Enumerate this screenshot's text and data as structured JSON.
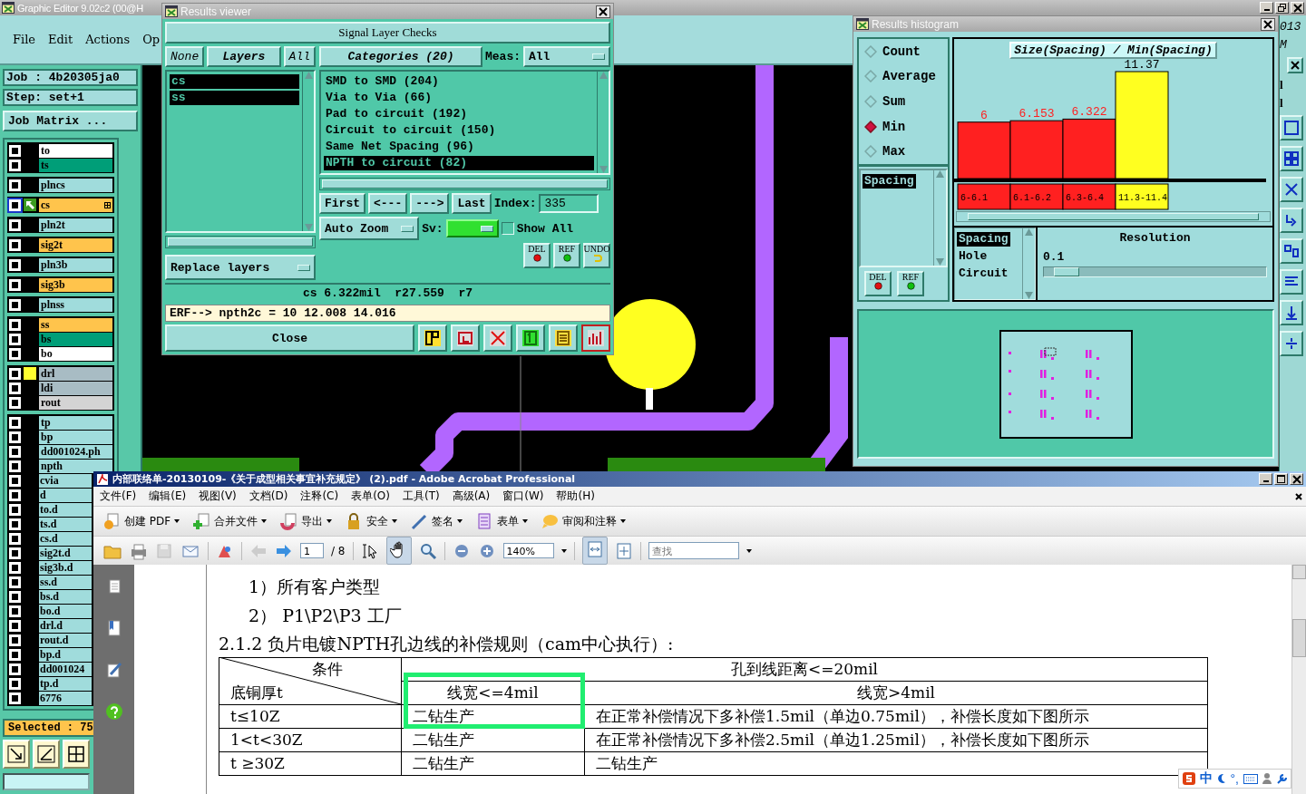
{
  "editor": {
    "title": "Graphic Editor 9.02c2 (00@H",
    "menu": [
      "File",
      "Edit",
      "Actions",
      "Op"
    ],
    "job": "Job : 4b20305ja0",
    "step": "Step: set+1",
    "job_matrix": "Job Matrix ...",
    "layer_groups": [
      [
        {
          "name": "to",
          "color": "#ffffff",
          "selected": false,
          "marked": false
        },
        {
          "name": "ts",
          "color": "#009e78",
          "selected": false,
          "marked": false
        }
      ],
      [
        {
          "name": "plncs",
          "color": "#a0dcdc",
          "selected": false,
          "marked": false
        }
      ],
      [
        {
          "name": "cs",
          "color": "#ffc44c",
          "selected": true,
          "marked": false
        }
      ],
      [
        {
          "name": "pln2t",
          "color": "#a0dcdc",
          "selected": false,
          "marked": false
        }
      ],
      [
        {
          "name": "sig2t",
          "color": "#ffc44c",
          "selected": false,
          "marked": false
        }
      ],
      [
        {
          "name": "pln3b",
          "color": "#a0dcdc",
          "selected": false,
          "marked": false
        }
      ],
      [
        {
          "name": "sig3b",
          "color": "#ffc44c",
          "selected": false,
          "marked": false
        }
      ],
      [
        {
          "name": "plnss",
          "color": "#a0dcdc",
          "selected": false,
          "marked": false
        }
      ],
      [
        {
          "name": "ss",
          "color": "#ffc44c",
          "selected": false,
          "marked": false
        },
        {
          "name": "bs",
          "color": "#009e78",
          "selected": false,
          "marked": false
        },
        {
          "name": "bo",
          "color": "#ffffff",
          "selected": false,
          "marked": false
        }
      ],
      [
        {
          "name": "drl",
          "color": "#a8bcc4",
          "selected": false,
          "marked": true
        },
        {
          "name": "ldi",
          "color": "#a8bcc4",
          "selected": false,
          "marked": false
        },
        {
          "name": "rout",
          "color": "#d4d4d4",
          "selected": false,
          "marked": false
        }
      ],
      [
        {
          "name": "tp",
          "color": "#a0dcdc",
          "selected": false,
          "marked": false
        },
        {
          "name": "bp",
          "color": "#a0dcdc",
          "selected": false,
          "marked": false
        },
        {
          "name": "dd001024.ph",
          "color": "#a0dcdc",
          "selected": false,
          "marked": false
        },
        {
          "name": "npth",
          "color": "#a0dcdc",
          "selected": false,
          "marked": false
        },
        {
          "name": "cvia",
          "color": "#a0dcdc",
          "selected": false,
          "marked": false
        },
        {
          "name": "d",
          "color": "#a0dcdc",
          "selected": false,
          "marked": false
        },
        {
          "name": "to.d",
          "color": "#a0dcdc",
          "selected": false,
          "marked": false
        },
        {
          "name": "ts.d",
          "color": "#a0dcdc",
          "selected": false,
          "marked": false
        },
        {
          "name": "cs.d",
          "color": "#a0dcdc",
          "selected": false,
          "marked": false
        },
        {
          "name": "sig2t.d",
          "color": "#a0dcdc",
          "selected": false,
          "marked": false
        },
        {
          "name": "sig3b.d",
          "color": "#a0dcdc",
          "selected": false,
          "marked": false
        },
        {
          "name": "ss.d",
          "color": "#a0dcdc",
          "selected": false,
          "marked": false
        },
        {
          "name": "bs.d",
          "color": "#a0dcdc",
          "selected": false,
          "marked": false
        },
        {
          "name": "bo.d",
          "color": "#a0dcdc",
          "selected": false,
          "marked": false
        },
        {
          "name": "drl.d",
          "color": "#a0dcdc",
          "selected": false,
          "marked": false
        },
        {
          "name": "rout.d",
          "color": "#a0dcdc",
          "selected": false,
          "marked": false
        },
        {
          "name": "bp.d",
          "color": "#a0dcdc",
          "selected": false,
          "marked": false
        },
        {
          "name": "dd001024",
          "color": "#a0dcdc",
          "selected": false,
          "marked": false
        },
        {
          "name": "tp.d",
          "color": "#a0dcdc",
          "selected": false,
          "marked": false
        },
        {
          "name": "6776",
          "color": "#a0dcdc",
          "selected": false,
          "marked": false
        }
      ]
    ],
    "selected_count": "Selected : 75",
    "corner_texts": [
      "013",
      "M"
    ],
    "strip_labels": [
      "l",
      "l"
    ]
  },
  "results_viewer": {
    "title": "Results viewer",
    "header": "Signal Layer Checks",
    "layer_buttons": [
      "None",
      "Layers",
      "All"
    ],
    "layers": [
      {
        "name": "cs",
        "selected": true
      },
      {
        "name": "ss",
        "selected": true
      }
    ],
    "categories_button": "Categories (20)",
    "meas_label": "Meas:",
    "meas_value": "All",
    "categories": [
      {
        "name": "SMD to SMD (204)",
        "selected": false
      },
      {
        "name": "Via to Via (66)",
        "selected": false
      },
      {
        "name": "Pad to circuit (192)",
        "selected": false
      },
      {
        "name": "Circuit to circuit (150)",
        "selected": false
      },
      {
        "name": "Same Net Spacing (96)",
        "selected": false
      },
      {
        "name": "NPTH to circuit (82)",
        "selected": true
      }
    ],
    "nav_buttons": [
      "First",
      "<---",
      "--->",
      "Last"
    ],
    "index_label": "Index:",
    "index_value": "335",
    "zoom_mode": "Auto Zoom",
    "sv_label": "Sv:",
    "show_all": {
      "label": "Show All",
      "checked": false
    },
    "replace_mode": "Replace layers",
    "mark_buttons": [
      "DEL",
      "REF",
      "UNDO"
    ],
    "status": "cs 6.322mil  r27.559  r7",
    "erf": "ERF--> npth2c = 10 12.008 14.016",
    "close": "Close"
  },
  "results_histogram": {
    "title": "Results histogram",
    "modes": [
      {
        "label": "Count",
        "selected": false
      },
      {
        "label": "Average",
        "selected": false
      },
      {
        "label": "Sum",
        "selected": false
      },
      {
        "label": "Min",
        "selected": true
      },
      {
        "label": "Max",
        "selected": false
      }
    ],
    "attributes": [
      {
        "name": "Spacing",
        "selected": true
      }
    ],
    "mark_buttons": [
      "DEL",
      "REF"
    ],
    "chart_data": {
      "type": "bar",
      "title": "Size(Spacing) / Min(Spacing)",
      "categories": [
        "6-6.1",
        "6.1-6.2",
        "6.3-6.4",
        "11.3-11.4"
      ],
      "stacked": true,
      "data_labels": true,
      "series": [
        {
          "color": "#ff2020",
          "values": [
            6,
            6.153,
            6.322,
            null
          ]
        },
        {
          "color": "#ffff20",
          "values": [
            null,
            null,
            null,
            11.37
          ]
        }
      ]
    },
    "measures": [
      {
        "name": "Spacing",
        "selected": true
      },
      {
        "name": "Hole",
        "selected": false
      },
      {
        "name": "Circuit",
        "selected": false
      }
    ],
    "resolution_label": "Resolution",
    "resolution_value": "0.1",
    "resolution_slider": {
      "level": 0.05
    }
  },
  "acrobat": {
    "title": "内部联络单-20130109-《关于成型相关事宜补充规定》 (2).pdf - Adobe Acrobat Professional",
    "menu": [
      "文件(F)",
      "编辑(E)",
      "视图(V)",
      "文档(D)",
      "注释(C)",
      "表单(O)",
      "工具(T)",
      "高级(A)",
      "窗口(W)",
      "帮助(H)"
    ],
    "tasks": [
      "创建 PDF",
      "合并文件",
      "导出",
      "安全",
      "签名",
      "表单",
      "审阅和注释"
    ],
    "page": "1",
    "page_count": "/ 8",
    "zoom": "140%",
    "search_placeholder": "查找",
    "document": {
      "items": [
        "1）所有客户类型",
        "2） P1\\P2\\P3 工厂"
      ],
      "heading": "2.1.2 负片电镀NPTH孔边线的补偿规则（cam中心执行）:",
      "table": {
        "header_rows": [
          [
            "条件",
            "孔到线距离<=20mil"
          ],
          [
            "底铜厚t",
            "线宽<=4mil",
            "线宽>4mil"
          ]
        ],
        "rows": [
          [
            "t≤10Z",
            "二钻生产",
            "在正常补偿情况下多补偿1.5mil（单边0.75mil），补偿长度如下图所示"
          ],
          [
            "1<t<30Z",
            "二钻生产",
            "在正常补偿情况下多补偿2.5mil（单边1.25mil），补偿长度如下图所示"
          ],
          [
            "t ≥30Z",
            "二钻生产",
            "二钻生产"
          ]
        ]
      }
    },
    "ime": {
      "mode": "中",
      "punct": "°,"
    }
  }
}
